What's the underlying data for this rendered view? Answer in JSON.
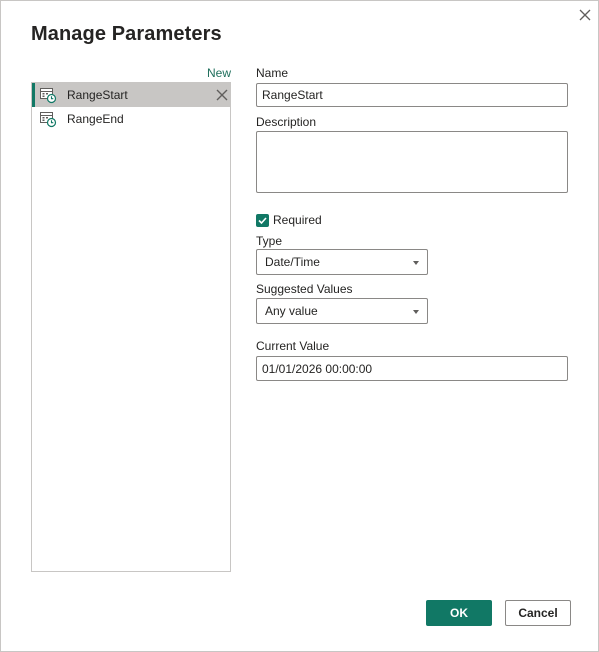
{
  "dialog": {
    "title": "Manage Parameters",
    "close_icon": "close-icon"
  },
  "list": {
    "new_label": "New",
    "items": [
      {
        "label": "RangeStart",
        "selected": true,
        "icon": "parameter-datetime-icon"
      },
      {
        "label": "RangeEnd",
        "selected": false,
        "icon": "parameter-datetime-icon"
      }
    ]
  },
  "form": {
    "name_label": "Name",
    "name_value": "RangeStart",
    "description_label": "Description",
    "description_value": "",
    "required_label": "Required",
    "required_checked": true,
    "type_label": "Type",
    "type_value": "Date/Time",
    "suggested_label": "Suggested Values",
    "suggested_value": "Any value",
    "current_label": "Current Value",
    "current_value": "01/01/2026 00:00:00"
  },
  "buttons": {
    "ok": "OK",
    "cancel": "Cancel"
  },
  "colors": {
    "accent": "#117865",
    "link": "#1f6f5c",
    "selected_bg": "#c8c6c4",
    "border": "#8a8886"
  }
}
